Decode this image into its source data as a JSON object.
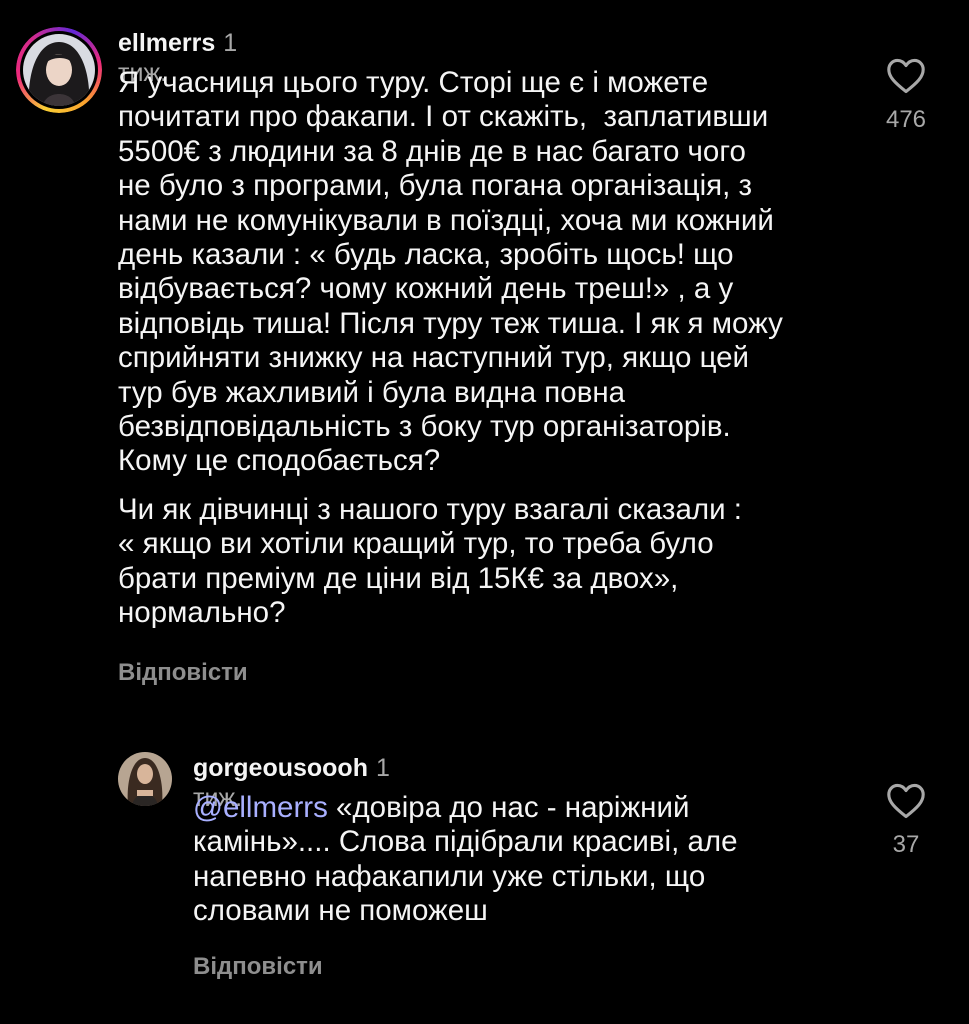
{
  "comments": [
    {
      "username": "ellmerrs",
      "time": "1 тиж.",
      "paragraph1_lines": [
        "Я учасниця цього туру. Сторі ще є і можете",
        "почитати про факапи. І от скажіть,  заплативши",
        "5500€ з людини за 8 днів де в нас багато чого",
        "не було з програми, була погана організація, з",
        "нами не комунікували в поїздці, хоча ми кожний",
        "день казали : « будь ласка, зробіть щось! що",
        "відбувається? чому кожний день треш!» , а у",
        "відповідь тиша! Після туру теж тиша. І як я можу",
        "сприйняти знижку на наступний тур, якщо цей",
        "тур був жахливий і була видна повна",
        "безвідповідальність з боку тур організаторів.",
        "Кому це сподобається?"
      ],
      "paragraph2_lines": [
        "Чи як дівчинці з нашого туру взагалі сказали :",
        "« якщо ви хотіли кращий тур, то треба було",
        "брати преміум де ціни від 15К€ за двох»,",
        "нормально?"
      ],
      "reply_label": "Відповісти",
      "like_count": "476",
      "like_icon": "heart-outline-icon"
    },
    {
      "username": "gorgeousoooh",
      "time": "1 тиж.",
      "mention": "@ellmerrs",
      "first_line_rest": " «довіра до нас - наріжний",
      "lines": [
        "камінь».... Слова підібрали красиві, але",
        "напевно нафакапили уже стільки, що",
        "словами не поможеш"
      ],
      "reply_label": "Відповісти",
      "like_count": "37",
      "like_icon": "heart-outline-icon"
    }
  ],
  "colors": {
    "background": "#000000",
    "text": "#f5f5f5",
    "muted": "#a8a8a8",
    "mention": "#a9b0ff",
    "story_ring": "#ee2a7b"
  }
}
